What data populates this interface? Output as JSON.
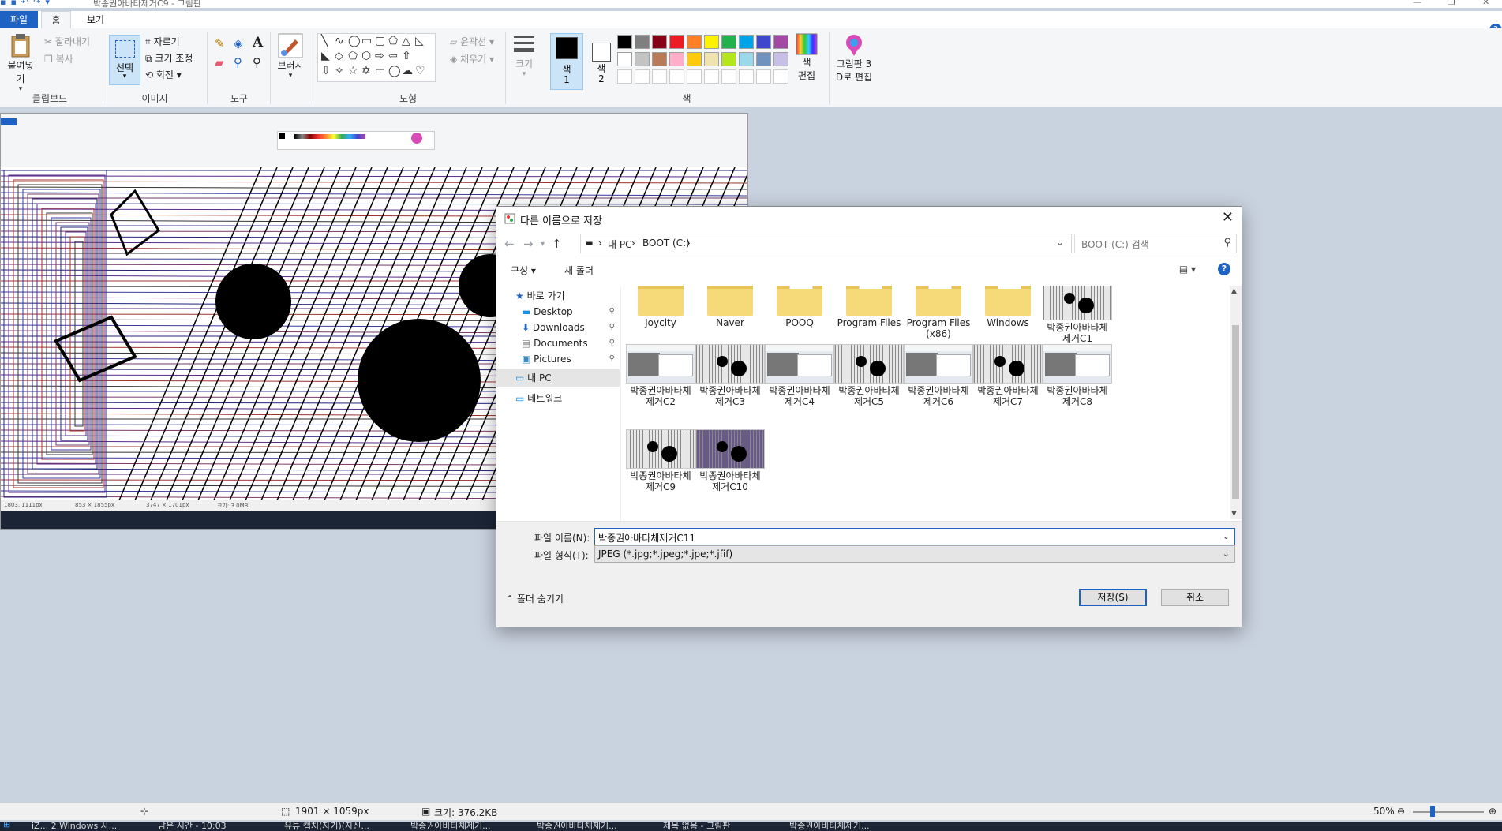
{
  "window": {
    "title": "박종권아바타제거C9 - 그림판"
  },
  "ribbon": {
    "tabs": [
      "파일",
      "홈",
      "보기"
    ],
    "clipboard": {
      "paste": "붙여넣기",
      "cut": "잘라내기",
      "copy": "복사",
      "group": "클립보드"
    },
    "image": {
      "select": "선택",
      "crop": "자르기",
      "resize": "크기 조정",
      "rotate": "회전",
      "group": "이미지"
    },
    "tools": {
      "group": "도구"
    },
    "brushes": {
      "label": "브러시"
    },
    "shapes": {
      "outline": "윤곽선",
      "fill": "채우기",
      "group": "도형"
    },
    "size": {
      "label": "크기"
    },
    "colors": {
      "color1": "색\n1",
      "color1_a": "색",
      "color1_b": "1",
      "color2_a": "색",
      "color2_b": "2",
      "edit_a": "색",
      "edit_b": "편집",
      "group": "색",
      "palette_row1": [
        "#000000",
        "#7f7f7f",
        "#880015",
        "#ed1c24",
        "#ff7f27",
        "#fff200",
        "#22b14c",
        "#00a2e8",
        "#3f48cc",
        "#a349a4"
      ],
      "palette_row2": [
        "#ffffff",
        "#c3c3c3",
        "#b97a57",
        "#ffaec9",
        "#ffc90e",
        "#efe4b0",
        "#b5e61d",
        "#99d9ea",
        "#7092be",
        "#c8bfe7"
      ]
    },
    "paint3d": {
      "line1": "그림판 3",
      "line2": "D로 편집"
    }
  },
  "dialog": {
    "title": "다른 이름으로 저장",
    "address": {
      "root": "내 PC",
      "drive": "BOOT (C:)"
    },
    "search_placeholder": "BOOT (C:) 검색",
    "organize": "구성",
    "new_folder": "새 폴더",
    "nav": {
      "quick_access": "바로 가기",
      "desktop": "Desktop",
      "downloads": "Downloads",
      "documents": "Documents",
      "pictures": "Pictures",
      "this_pc": "내 PC",
      "network": "네트워크"
    },
    "folders": [
      "Joycity",
      "Naver",
      "POOQ",
      "Program Files",
      "Program Files (x86)",
      "Windows"
    ],
    "files": [
      "박종권아바타체제거C1",
      "박종권아바타체제거C2",
      "박종권아바타체제거C3",
      "박종권아바타체제거C4",
      "박종권아바타체제거C5",
      "박종권아바타체제거C6",
      "박종권아바타체제거C7",
      "박종권아바타체제거C8",
      "박종권아바타체제거C9",
      "박종권아바타체제거C10"
    ],
    "filename_label": "파일 이름(N):",
    "filename_value": "박종권아바타체제거C11",
    "filetype_label": "파일 형식(T):",
    "filetype_value": "JPEG (*.jpg;*.jpeg;*.jpe;*.jfif)",
    "hide_folders": "폴더 숨기기",
    "save": "저장(S)",
    "cancel": "취소"
  },
  "statusbar": {
    "dimensions": "1901 × 1059px",
    "size": "크기: 376.2KB",
    "zoom": "50%"
  },
  "inner_status": {
    "pos": "1803, 1111px",
    "sel": "853 × 1855px",
    "dims": "3747 × 1701px",
    "size": "크기: 3.0MB"
  },
  "taskbar": {
    "items": [
      "iZ... 2 Windows 사...",
      "남은 시간 - 10:03",
      "유튜 캡처(자기)(자신...",
      "박종권아바타체제거...",
      "박종권아바타체제거...",
      "제목 없음 - 그림판",
      "박종권아바타체제거..."
    ]
  }
}
